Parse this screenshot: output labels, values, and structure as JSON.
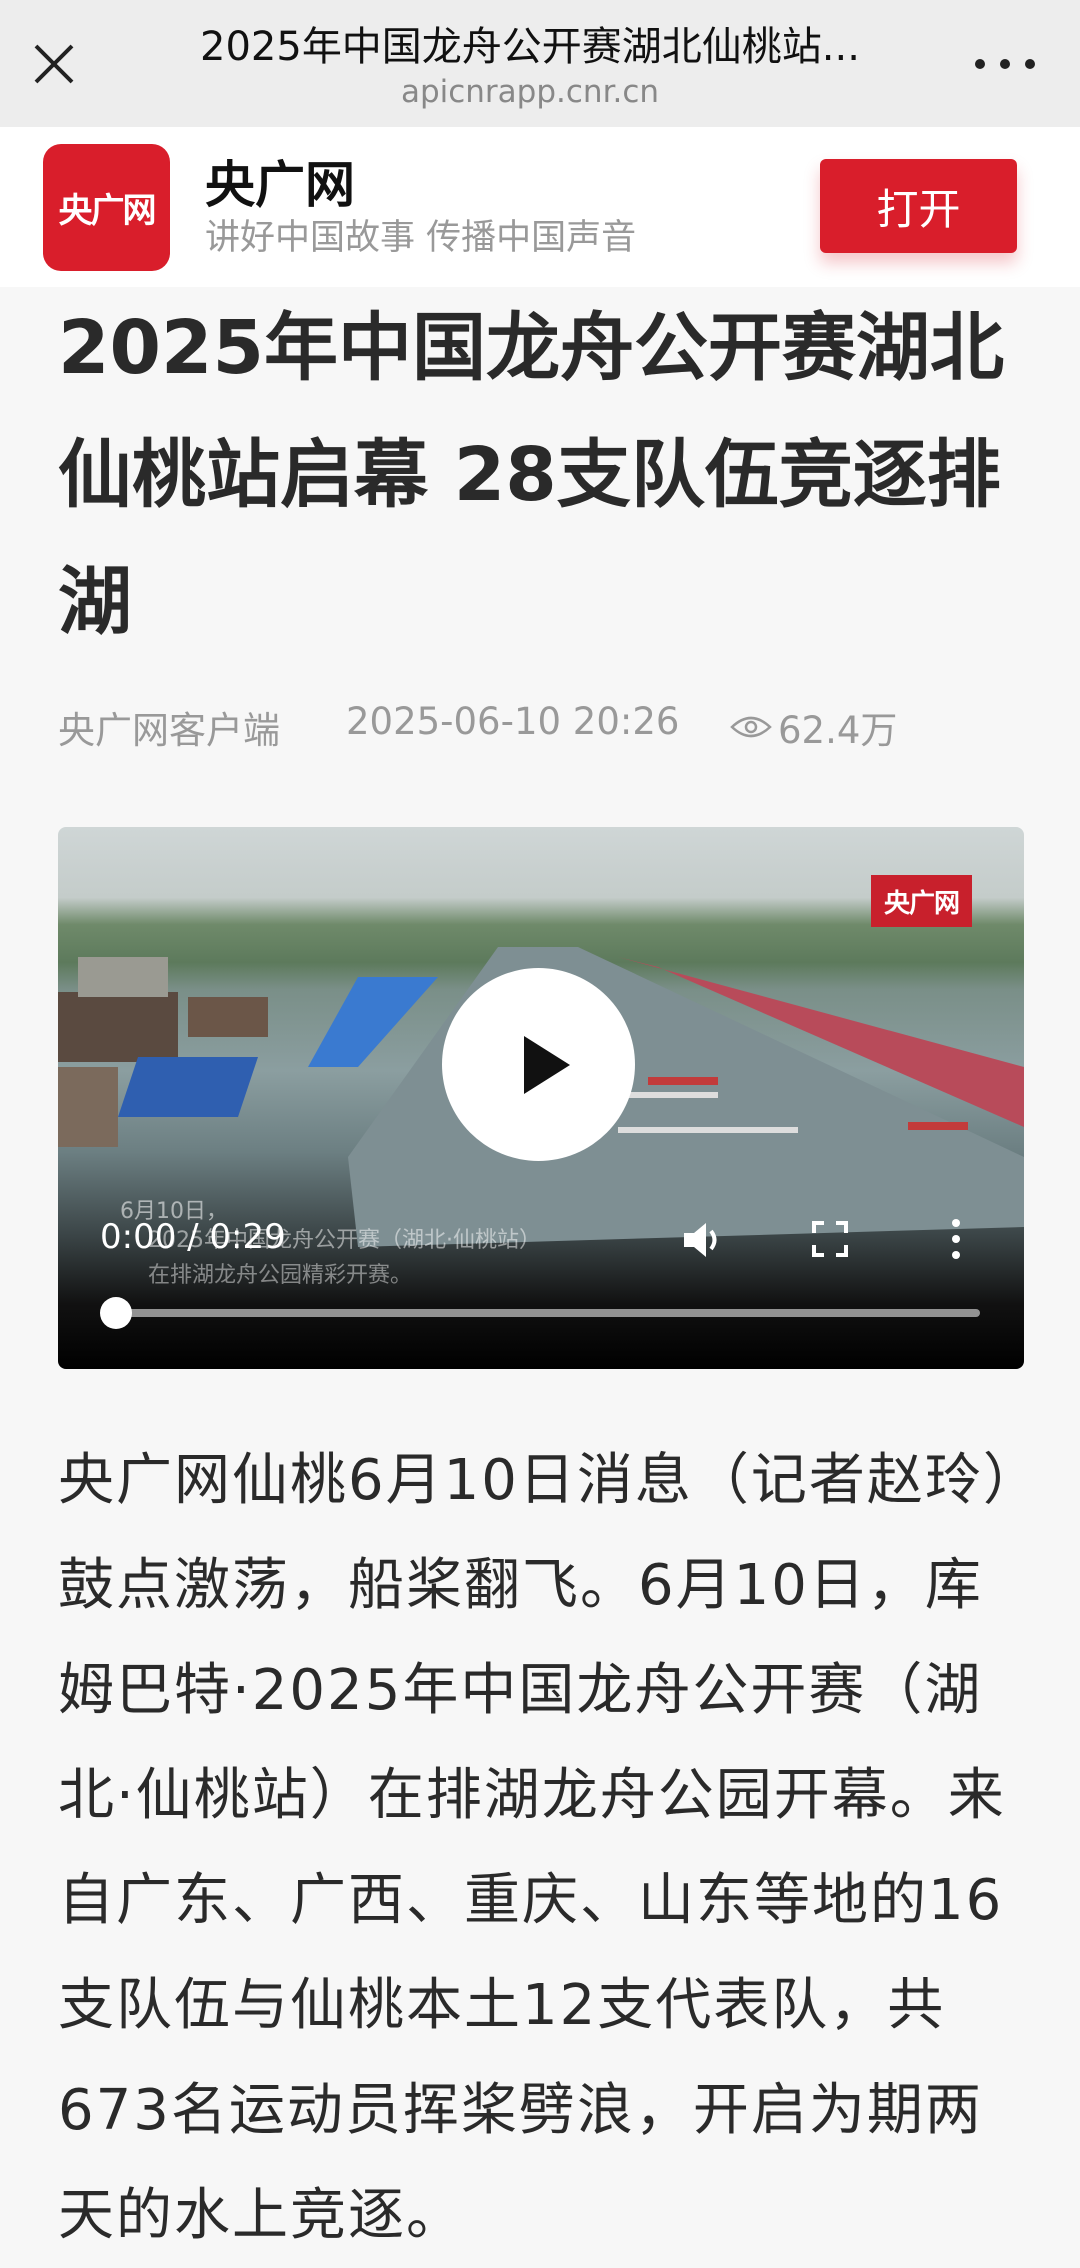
{
  "browser": {
    "title": "2025年中国龙舟公开赛湖北仙桃站...",
    "url": "apicnrapp.cnr.cn"
  },
  "app_banner": {
    "logo_text": "央广网",
    "name": "央广网",
    "slogan": "讲好中国故事 传播中国声音",
    "open_label": "打开"
  },
  "article": {
    "headline": "2025年中国龙舟公开赛湖北仙桃站启幕 28支队伍竞逐排湖",
    "source": "央广网客户端",
    "datetime": "2025-06-10 20:26",
    "views": "62.4万",
    "body": "央广网仙桃6月10日消息（记者赵玲）鼓点激荡，船桨翻飞。6月10日，库姆巴特·2025年中国龙舟公开赛（湖北·仙桃站）在排湖龙舟公园开幕。来自广东、广西、重庆、山东等地的16支队伍与仙桃本土12支代表队，共673名运动员挥桨劈浪，开启为期两天的水上竞逐。"
  },
  "video": {
    "watermark": "央广网",
    "caption_date": "6月10日，",
    "caption_line1": "2025年中国龙舟公开赛（湖北·仙桃站）",
    "caption_line2": "在排湖龙舟公园精彩开赛。",
    "timecode": "0:00 / 0:29",
    "progress": 0
  },
  "colors": {
    "brand_red": "#d91e2b"
  }
}
